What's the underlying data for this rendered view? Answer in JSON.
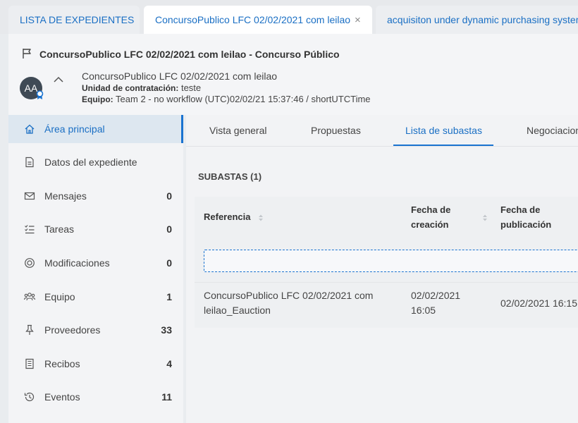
{
  "tabs": [
    {
      "label": "LISTA DE EXPEDIENTES",
      "closable": false
    },
    {
      "label": "ConcursoPublico LFC 02/02/2021 com leilao",
      "closable": true
    },
    {
      "label": "acquisiton under dynamic purchasing system",
      "closable": false
    }
  ],
  "tab_close_glyph": "×",
  "header": {
    "title": "ConcursoPublico LFC 02/02/2021 com leilao - Concurso Público",
    "avatar_initials": "AA",
    "name": "ConcursoPublico LFC 02/02/2021 com leilao",
    "unidad_label": "Unidad de contratación:",
    "unidad_value": "teste",
    "equipo_label": "Equipo:",
    "equipo_value": "Team 2 - no workflow (UTC)02/02/21 15:37:46 / shortUTCTime"
  },
  "sidebar": {
    "items": [
      {
        "label": "Área principal",
        "count": "",
        "icon": "home-icon",
        "active": true
      },
      {
        "label": "Datos del expediente",
        "count": "",
        "icon": "document-icon"
      },
      {
        "label": "Mensajes",
        "count": "0",
        "icon": "mail-icon"
      },
      {
        "label": "Tareas",
        "count": "0",
        "icon": "checklist-icon"
      },
      {
        "label": "Modificaciones",
        "count": "0",
        "icon": "target-icon"
      },
      {
        "label": "Equipo",
        "count": "1",
        "icon": "team-icon"
      },
      {
        "label": "Proveedores",
        "count": "33",
        "icon": "pin-icon"
      },
      {
        "label": "Recibos",
        "count": "4",
        "icon": "receipt-icon"
      },
      {
        "label": "Eventos",
        "count": "11",
        "icon": "history-icon"
      }
    ]
  },
  "main": {
    "subtabs": [
      "Vista general",
      "Propuestas",
      "Lista de subastas",
      "Negociaciones"
    ],
    "active_subtab": "Lista de subastas",
    "section_title": "SUBASTAS (1)",
    "columns": {
      "referencia": "Referencia",
      "fecha_creacion_1": "Fecha de",
      "fecha_creacion_2": "creación",
      "fecha_publicacion_1": "Fecha de",
      "fecha_publicacion_2": "publicación"
    },
    "rows": [
      {
        "ref_1": "ConcursoPublico LFC 02/02/2021 com",
        "ref_2": "leilao_Eauction",
        "created_1": "02/02/2021",
        "created_2": "16:05",
        "published": "02/02/2021 16:15"
      }
    ]
  },
  "colors": {
    "accent": "#1a73d0",
    "link": "#1a6fc4",
    "active_bg": "#dde7f0"
  }
}
